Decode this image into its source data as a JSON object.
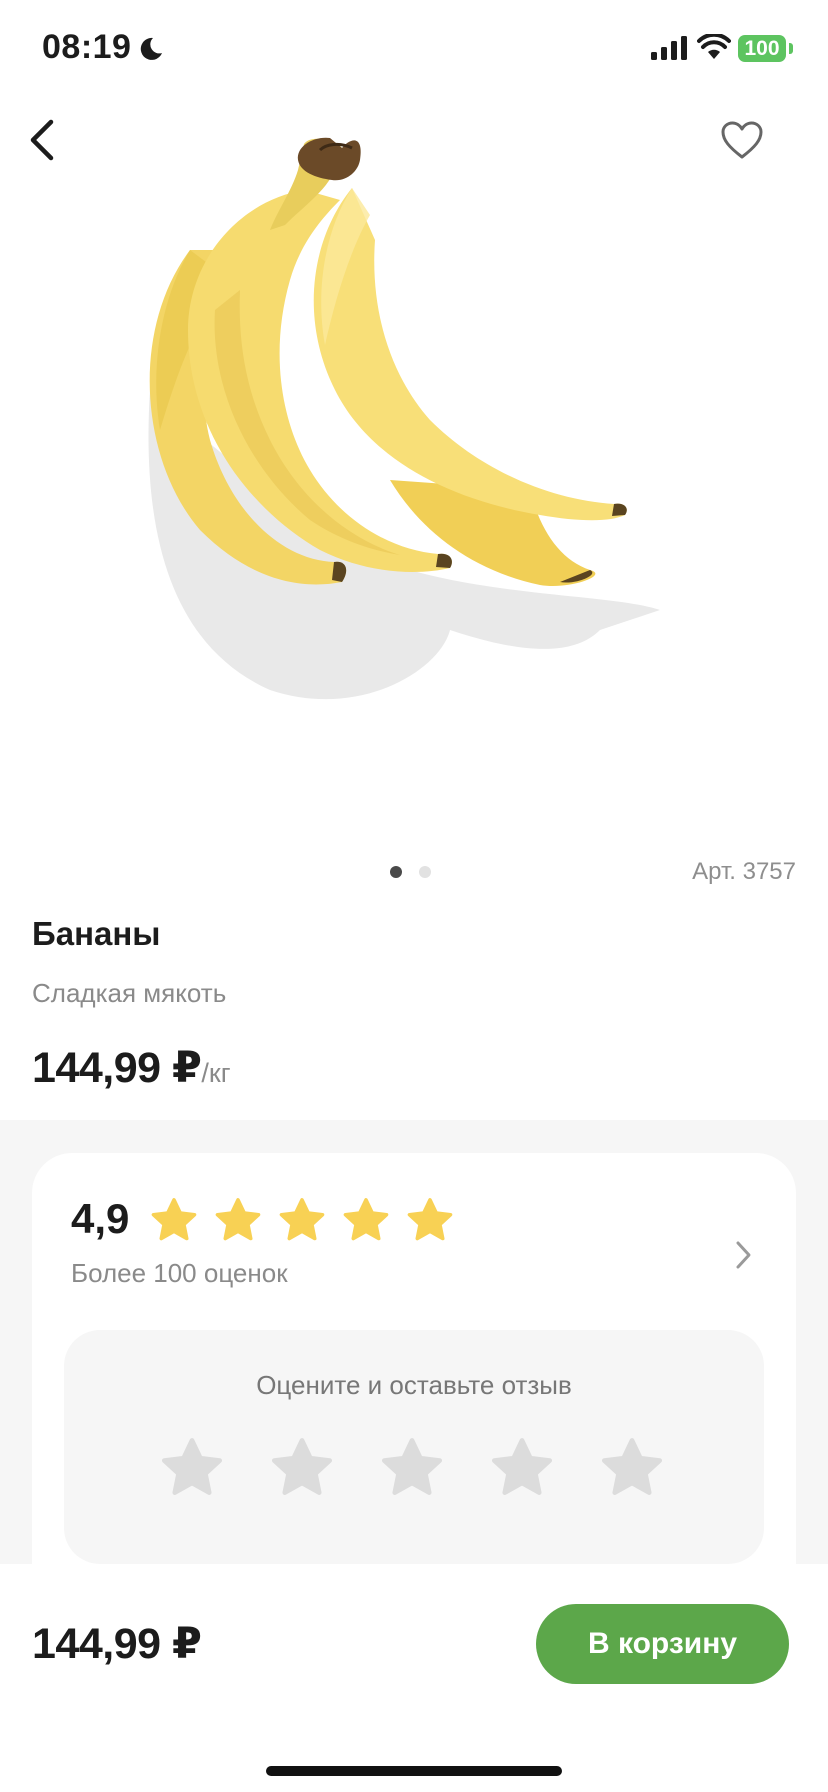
{
  "status_bar": {
    "time": "08:19",
    "battery": "100"
  },
  "product": {
    "article": "Арт. 3757",
    "title": "Бананы",
    "subtitle": "Сладкая мякоть",
    "price": "144,99 ₽",
    "unit": "/кг"
  },
  "gallery": {
    "pages": 2,
    "active": 1
  },
  "rating": {
    "value": "4,9",
    "stars_filled": 5,
    "count_text": "Более 100 оценок",
    "prompt": "Оцените и оставьте отзыв"
  },
  "bottom_bar": {
    "price": "144,99 ₽",
    "cart_label": "В корзину"
  },
  "colors": {
    "accent_green": "#5ca74a",
    "star_yellow": "#f8d154",
    "star_empty": "#dcdcdc",
    "battery_green": "#5dc460"
  }
}
